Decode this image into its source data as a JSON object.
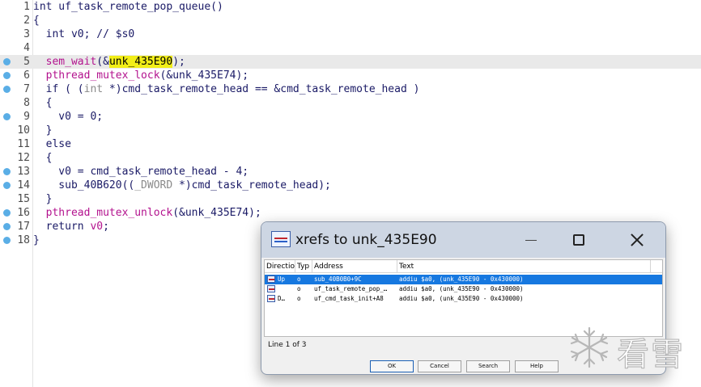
{
  "editor": {
    "lines": [
      {
        "n": "1",
        "bp": false,
        "hl": false,
        "tokens": [
          [
            "k",
            "int uf_task_remote_pop_queue()"
          ]
        ]
      },
      {
        "n": "2",
        "bp": false,
        "hl": false,
        "tokens": [
          [
            "k",
            "{"
          ]
        ]
      },
      {
        "n": "3",
        "bp": false,
        "hl": false,
        "tokens": [
          [
            "k",
            "  int v0; // $s0"
          ]
        ]
      },
      {
        "n": "4",
        "bp": false,
        "hl": false,
        "tokens": []
      },
      {
        "n": "5",
        "bp": true,
        "hl": true,
        "tokens": [
          [
            "k",
            "  "
          ],
          [
            "f",
            "sem_wait"
          ],
          [
            "k",
            "(&"
          ],
          [
            "sel",
            "unk_435E90"
          ],
          [
            "k",
            ");"
          ]
        ]
      },
      {
        "n": "6",
        "bp": true,
        "hl": false,
        "tokens": [
          [
            "k",
            "  "
          ],
          [
            "f",
            "pthread_mutex_lock"
          ],
          [
            "k",
            "(&unk_435E74);"
          ]
        ]
      },
      {
        "n": "7",
        "bp": true,
        "hl": false,
        "tokens": [
          [
            "k",
            "  if ( ("
          ],
          [
            "t",
            "int"
          ],
          [
            "k",
            " *)cmd_task_remote_head == &cmd_task_remote_head )"
          ]
        ]
      },
      {
        "n": "8",
        "bp": false,
        "hl": false,
        "tokens": [
          [
            "k",
            "  {"
          ]
        ]
      },
      {
        "n": "9",
        "bp": true,
        "hl": false,
        "tokens": [
          [
            "k",
            "    v0 = 0;"
          ]
        ]
      },
      {
        "n": "10",
        "bp": false,
        "hl": false,
        "tokens": [
          [
            "k",
            "  }"
          ]
        ]
      },
      {
        "n": "11",
        "bp": false,
        "hl": false,
        "tokens": [
          [
            "k",
            "  else"
          ]
        ]
      },
      {
        "n": "12",
        "bp": false,
        "hl": false,
        "tokens": [
          [
            "k",
            "  {"
          ]
        ]
      },
      {
        "n": "13",
        "bp": true,
        "hl": false,
        "tokens": [
          [
            "k",
            "    v0 = cmd_task_remote_head - 4;"
          ]
        ]
      },
      {
        "n": "14",
        "bp": true,
        "hl": false,
        "tokens": [
          [
            "k",
            "    sub_40B620(("
          ],
          [
            "t",
            "_DWORD"
          ],
          [
            "k",
            " *)cmd_task_remote_head);"
          ]
        ]
      },
      {
        "n": "15",
        "bp": false,
        "hl": false,
        "tokens": [
          [
            "k",
            "  }"
          ]
        ]
      },
      {
        "n": "16",
        "bp": true,
        "hl": false,
        "tokens": [
          [
            "k",
            "  "
          ],
          [
            "f",
            "pthread_mutex_unlock"
          ],
          [
            "k",
            "(&unk_435E74);"
          ]
        ]
      },
      {
        "n": "17",
        "bp": true,
        "hl": false,
        "tokens": [
          [
            "k",
            "  return "
          ],
          [
            "f",
            "v0"
          ],
          [
            "k",
            ";"
          ]
        ]
      },
      {
        "n": "18",
        "bp": true,
        "hl": false,
        "tokens": [
          [
            "k",
            "}"
          ]
        ]
      }
    ]
  },
  "dialog": {
    "title": "xrefs to unk_435E90",
    "columns": [
      "Directio",
      "Typ",
      "Address",
      "Text"
    ],
    "rows": [
      {
        "selected": true,
        "direction": "Up",
        "type": "o",
        "address": "sub_40B0B0+9C",
        "text": "addiu   $a0, (unk_435E90 - 0x430000)"
      },
      {
        "selected": false,
        "direction": "",
        "type": "o",
        "address": "uf_task_remote_pop_…",
        "text": "addiu   $a0, (unk_435E90 - 0x430000)"
      },
      {
        "selected": false,
        "direction": "D…",
        "type": "o",
        "address": "uf_cmd_task_init+A8",
        "text": "addiu   $a0, (unk_435E90 - 0x430000)"
      }
    ],
    "status": "Line 1 of 3",
    "buttons": {
      "ok": "OK",
      "cancel": "Cancel",
      "search": "Search",
      "help": "Help"
    }
  },
  "watermark": {
    "text": "看雪"
  },
  "colors": {
    "accent_selection": "#1678e0",
    "highlight": "#f2ee17",
    "breakpoint": "#5aaee6",
    "function": "#b3128e"
  }
}
